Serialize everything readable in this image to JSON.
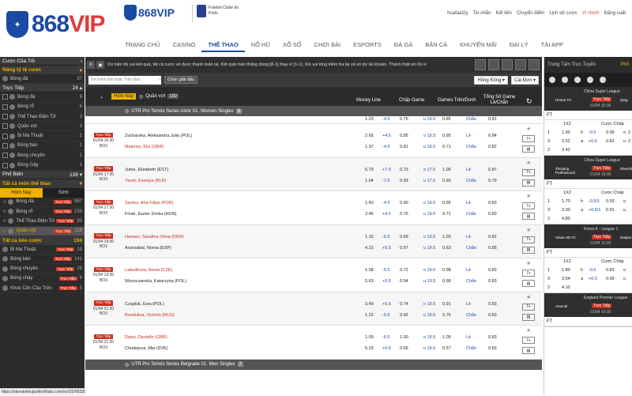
{
  "header": {
    "brand": "868VIP",
    "brand_num": "868",
    "brand_suffix": "VIP",
    "brand2": "868VIP",
    "partner": "Futebol Clube do Porto",
    "user": [
      "huafaat2y",
      "Tin nhắn",
      "Kết tiền",
      "Chuyển điểm",
      "Lịch sử cược",
      "Ví chính"
    ],
    "logout": "Đăng xuất",
    "nav": [
      "TRANG CHỦ",
      "CASINO",
      "THỂ THAO",
      "NỔ HŨ",
      "XỔ SỐ",
      "CHƠI BÀI",
      "ESPORTS",
      "ĐÁ GÀ",
      "BẮN CÁ",
      "KHUYẾN MÃI",
      "ĐẠI LÝ",
      "TẢI APP"
    ]
  },
  "left": {
    "my_bets": "Cược Của Tôi",
    "boost": "Nâng tỷ lệ cược",
    "boost_item": {
      "name": "Bóng đá",
      "count": "37"
    },
    "live_head": "Trực Tiếp",
    "live_count": "24",
    "live_items": [
      {
        "name": "Bóng đá",
        "count": "6"
      },
      {
        "name": "Bóng rổ",
        "count": "6"
      },
      {
        "name": "Thể Thao Điện Tử",
        "count": "3"
      },
      {
        "name": "Quần vợt",
        "count": "3"
      },
      {
        "name": "Bi Ma Thuật",
        "count": "2"
      },
      {
        "name": "Bóng bàn",
        "count": "2"
      },
      {
        "name": "Bóng chuyền",
        "count": "1"
      },
      {
        "name": "Bóng Gậy",
        "count": "1"
      }
    ],
    "popular": "Phổ Biến",
    "popular_count": "139",
    "all_sports": "Tất cả môn thể thao",
    "tabs": [
      "Hôm Nay",
      "Sớm"
    ],
    "pop_items": [
      {
        "name": "Bóng đá",
        "count": "967"
      },
      {
        "name": "Bóng rổ",
        "count": "239"
      },
      {
        "name": "Thể Thao Điện Tử",
        "count": "93"
      },
      {
        "name": "Quần vợt",
        "count": "118"
      }
    ],
    "all_bets": "Tất cả kèo cược",
    "all_bets_count": "194",
    "bet_items": [
      {
        "name": "Bi Ma Thuật",
        "count": "19"
      },
      {
        "name": "Bóng bàn",
        "count": "141"
      },
      {
        "name": "Bóng chuyền",
        "count": "28"
      },
      {
        "name": "Bóng chày",
        "count": "6"
      },
      {
        "name": "Khúc Côn Cầu Trên",
        "count": "5"
      }
    ],
    "live_tag": "Trực Tiếp"
  },
  "status": "https://sbosanlieujaulkrvhfadu.com/sv/3/2/99335242/1",
  "center": {
    "ticker": "Do hiện thị sai kết quả, tất cả cược về duoc thanh toán lại. Kết quả màn thắng đúng [8-1] thay vì [1-1]. Xin vui lòng kiểm tra lại và số dư tài khoản. Thành thật xin lỗi vì",
    "search_placeholder": "Tìm kiếm Đội hoặc Trận Đấu",
    "choose_league": "Chọn giải đấu",
    "odds_type": "Hồng Kông",
    "single": "Cái Đơn",
    "today": "Hôm Nay",
    "sport": "Quần vợt",
    "sport_count": "192",
    "cols": [
      "Money Line",
      "Chấp Game",
      "Games Trên/Dưới",
      "Tổng Số Game Lẻ/Chẵn"
    ],
    "league1": "UTR Pro Tennis Series Alvor 01. Women Singles",
    "league1_count": "8",
    "partial": {
      "o": "1.23",
      "h": "-4.5",
      "ho": "0.76",
      "u": "u 19.5",
      "uo": "0.85",
      "t": "Chẵn",
      "to": "0.81"
    },
    "matches": [
      {
        "tag": "Trực Tiếp",
        "date": "01/04 16:30",
        "bo": "BO3",
        "home": "Zucharoka, Aleksandra Julia (POL)",
        "away": "Maloney, Eliz (GBR)",
        "away_red": true,
        "ml": [
          "2.65",
          "1.37"
        ],
        "hc": [
          "+4.5",
          "0.85",
          "-4.5",
          "0.81"
        ],
        "ou": [
          "o 19.5",
          "0.95",
          "u 19.5",
          "0.71"
        ],
        "oe": [
          "Lẻ",
          "0.84",
          "Chẵn",
          "0.82"
        ]
      },
      {
        "tag": "Trực Tiếp",
        "date": "01/04 17:30",
        "bo": "BO3",
        "home": "Juma, Elizabeth (EST)",
        "away": "Yarsh, Kseniya (BLR)",
        "away_red": true,
        "ml": [
          "6.79",
          "1.04"
        ],
        "hc": [
          "+7.5",
          "0.73",
          "-7.5",
          "0.93"
        ],
        "ou": [
          "o 17.5",
          "1.06",
          "u 17.5",
          "0.60"
        ],
        "oe": [
          "Lẻ",
          "0.87",
          "Chẵn",
          "0.79"
        ]
      },
      {
        "tag": "Trực Tiếp",
        "date": "01/04 17:30",
        "bo": "BO3",
        "home": "Santos, Ana Filipa (POR)",
        "home_red": true,
        "away": "Finak, Eszter Dorka (HUN)",
        "ml": [
          "1.43",
          "2.45"
        ],
        "hc": [
          "-4.5",
          "0.90",
          "+4.5",
          "0.76"
        ],
        "ou": [
          "o 19.5",
          "0.95",
          "u 19.5",
          "0.71"
        ],
        "oe": [
          "Lẻ",
          "0.83",
          "Chẵn",
          "0.83"
        ]
      },
      {
        "tag": "Trực Tiếp",
        "date": "01/04 19:00",
        "bo": "BO3",
        "home": "Hansen, Sarafina Olivia (DEN)",
        "home_red": true,
        "away": "Aranzabal, Noroa (ESP)",
        "ml": [
          "1.15",
          "4.22"
        ],
        "hc": [
          "-5.5",
          "0.69",
          "+5.5",
          "0.97"
        ],
        "ou": [
          "o 19.5",
          "1.03",
          "u 19.5",
          "0.63"
        ],
        "oe": [
          "Lẻ",
          "0.81",
          "Chẵn",
          "0.85"
        ]
      },
      {
        "tag": "Trực Tiếp",
        "date": "01/04 19:30",
        "bo": "BO3",
        "home": "Labudkova, Aneta (CZE)",
        "home_red": true,
        "away": "Wysoczanska, Katarzyna (POL)",
        "ml": [
          "1.08",
          "5.63"
        ],
        "hc": [
          "-5.5",
          "0.72",
          "+5.5",
          "0.94"
        ],
        "ou": [
          "o 19.5",
          "0.98",
          "u 19.5",
          "0.68"
        ],
        "oe": [
          "Lẻ",
          "0.83",
          "Chẵn",
          "0.83"
        ]
      },
      {
        "tag": "Trực Tiếp",
        "date": "01/04 21:30",
        "bo": "BO3",
        "home": "Czapluk, Ewa (POL)",
        "away": "Bondulina, Victoria (RUS)",
        "away_red": true,
        "ml": [
          "3.49",
          "1.22"
        ],
        "hc": [
          "+5.5",
          "0.74",
          "-5.5",
          "0.92"
        ],
        "ou": [
          "o 19.5",
          "0.91",
          "u 19.5",
          "0.75"
        ],
        "oe": [
          "Lẻ",
          "0.83",
          "Chẵn",
          "0.83"
        ]
      },
      {
        "tag": "Trực Tiếp",
        "date": "01/04 21:30",
        "bo": "BO3",
        "home": "Daley, Danielle (GBR)",
        "home_red": true,
        "away": "Chudejova, Mia (SVK)",
        "ml": [
          "1.09",
          "5.29"
        ],
        "hc": [
          "-6.5",
          "1.00",
          "+6.5",
          "0.66"
        ],
        "ou": [
          "o 19.5",
          "1.09",
          "u 19.5",
          "0.57"
        ],
        "oe": [
          "Lẻ",
          "0.83",
          "Chẵn",
          "0.83"
        ]
      }
    ],
    "league2": "UTR Pro Tennis Series Belgrade 01. Men Singles",
    "league2_count": "7"
  },
  "right": {
    "title": "Trung Tâm Trực Tuyến",
    "tab_label": "Phổ",
    "cards": [
      {
        "league": "China Super League",
        "home": "Henan FC",
        "away": "Qing",
        "tag": "Trực Tiếp",
        "date": "01/04 15:30",
        "ft": "FT",
        "h1": "1X2",
        "h2": "Cược Chấp",
        "rows": [
          [
            "1",
            "1.90",
            "h",
            "-0.5",
            "0.99",
            "o",
            "2"
          ],
          [
            "X",
            "3.52",
            "a",
            "+0.5",
            "0.81",
            "u",
            "2"
          ],
          [
            "2",
            "3.42",
            "",
            "",
            "",
            "",
            ""
          ]
        ]
      },
      {
        "league": "China Super League",
        "home": "Zhejiang Professional",
        "away": "Shenzh",
        "tag": "Trực Tiếp",
        "date": "01/04 19:35",
        "ft": "FT",
        "h1": "1X2",
        "h2": "Cược Chấp",
        "rows": [
          [
            "1",
            "1.70",
            "h",
            "-0.5/1",
            "0.93",
            "o",
            ""
          ],
          [
            "X",
            "3.30",
            "a",
            "+0.5/1",
            "0.91",
            "u",
            ""
          ],
          [
            "2",
            "4.80",
            "",
            "",
            "",
            "",
            ""
          ]
        ]
      },
      {
        "league": "Korea K - League 1",
        "home": "Ulsan HD FC",
        "away": "Daejeo",
        "tag": "Trực Tiếp",
        "date": "01/04 12:00",
        "ft": "FT",
        "h1": "1X2",
        "h2": "Cược Chấp",
        "rows": [
          [
            "1",
            "1.80",
            "h",
            "-0.5",
            "0.83",
            "o",
            ""
          ],
          [
            "X",
            "3.54",
            "a",
            "+0.5",
            "0.99",
            "u",
            ""
          ],
          [
            "2",
            "4.10",
            "",
            "",
            "",
            "",
            ""
          ]
        ]
      },
      {
        "league": "England Premier League",
        "home": "Arsenal",
        "away": "",
        "tag": "Trực Tiếp",
        "date": "01/04 19:00",
        "ft": "FT",
        "h1": "",
        "h2": "",
        "rows": []
      }
    ]
  }
}
